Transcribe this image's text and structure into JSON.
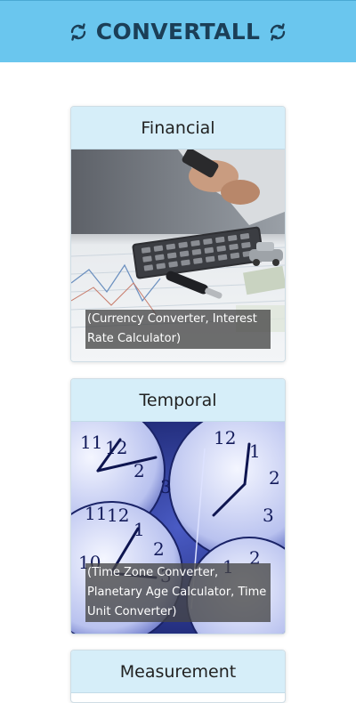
{
  "header": {
    "title": "CONVERTALL",
    "left_icon": "sync-icon",
    "right_icon": "sync-icon",
    "background_color": "#6ac6ee",
    "title_color": "#1b3f57"
  },
  "cards": [
    {
      "title": "Financial",
      "caption": "(Currency Converter, Interest Rate Calculator)",
      "image": "calculator-money-photo"
    },
    {
      "title": "Temporal",
      "caption": "(Time Zone Converter, Planetary Age Calculator, Time Unit Converter)",
      "image": "clocks-photo"
    },
    {
      "title": "Measurement"
    }
  ],
  "card_header_color": "#d6eef9"
}
